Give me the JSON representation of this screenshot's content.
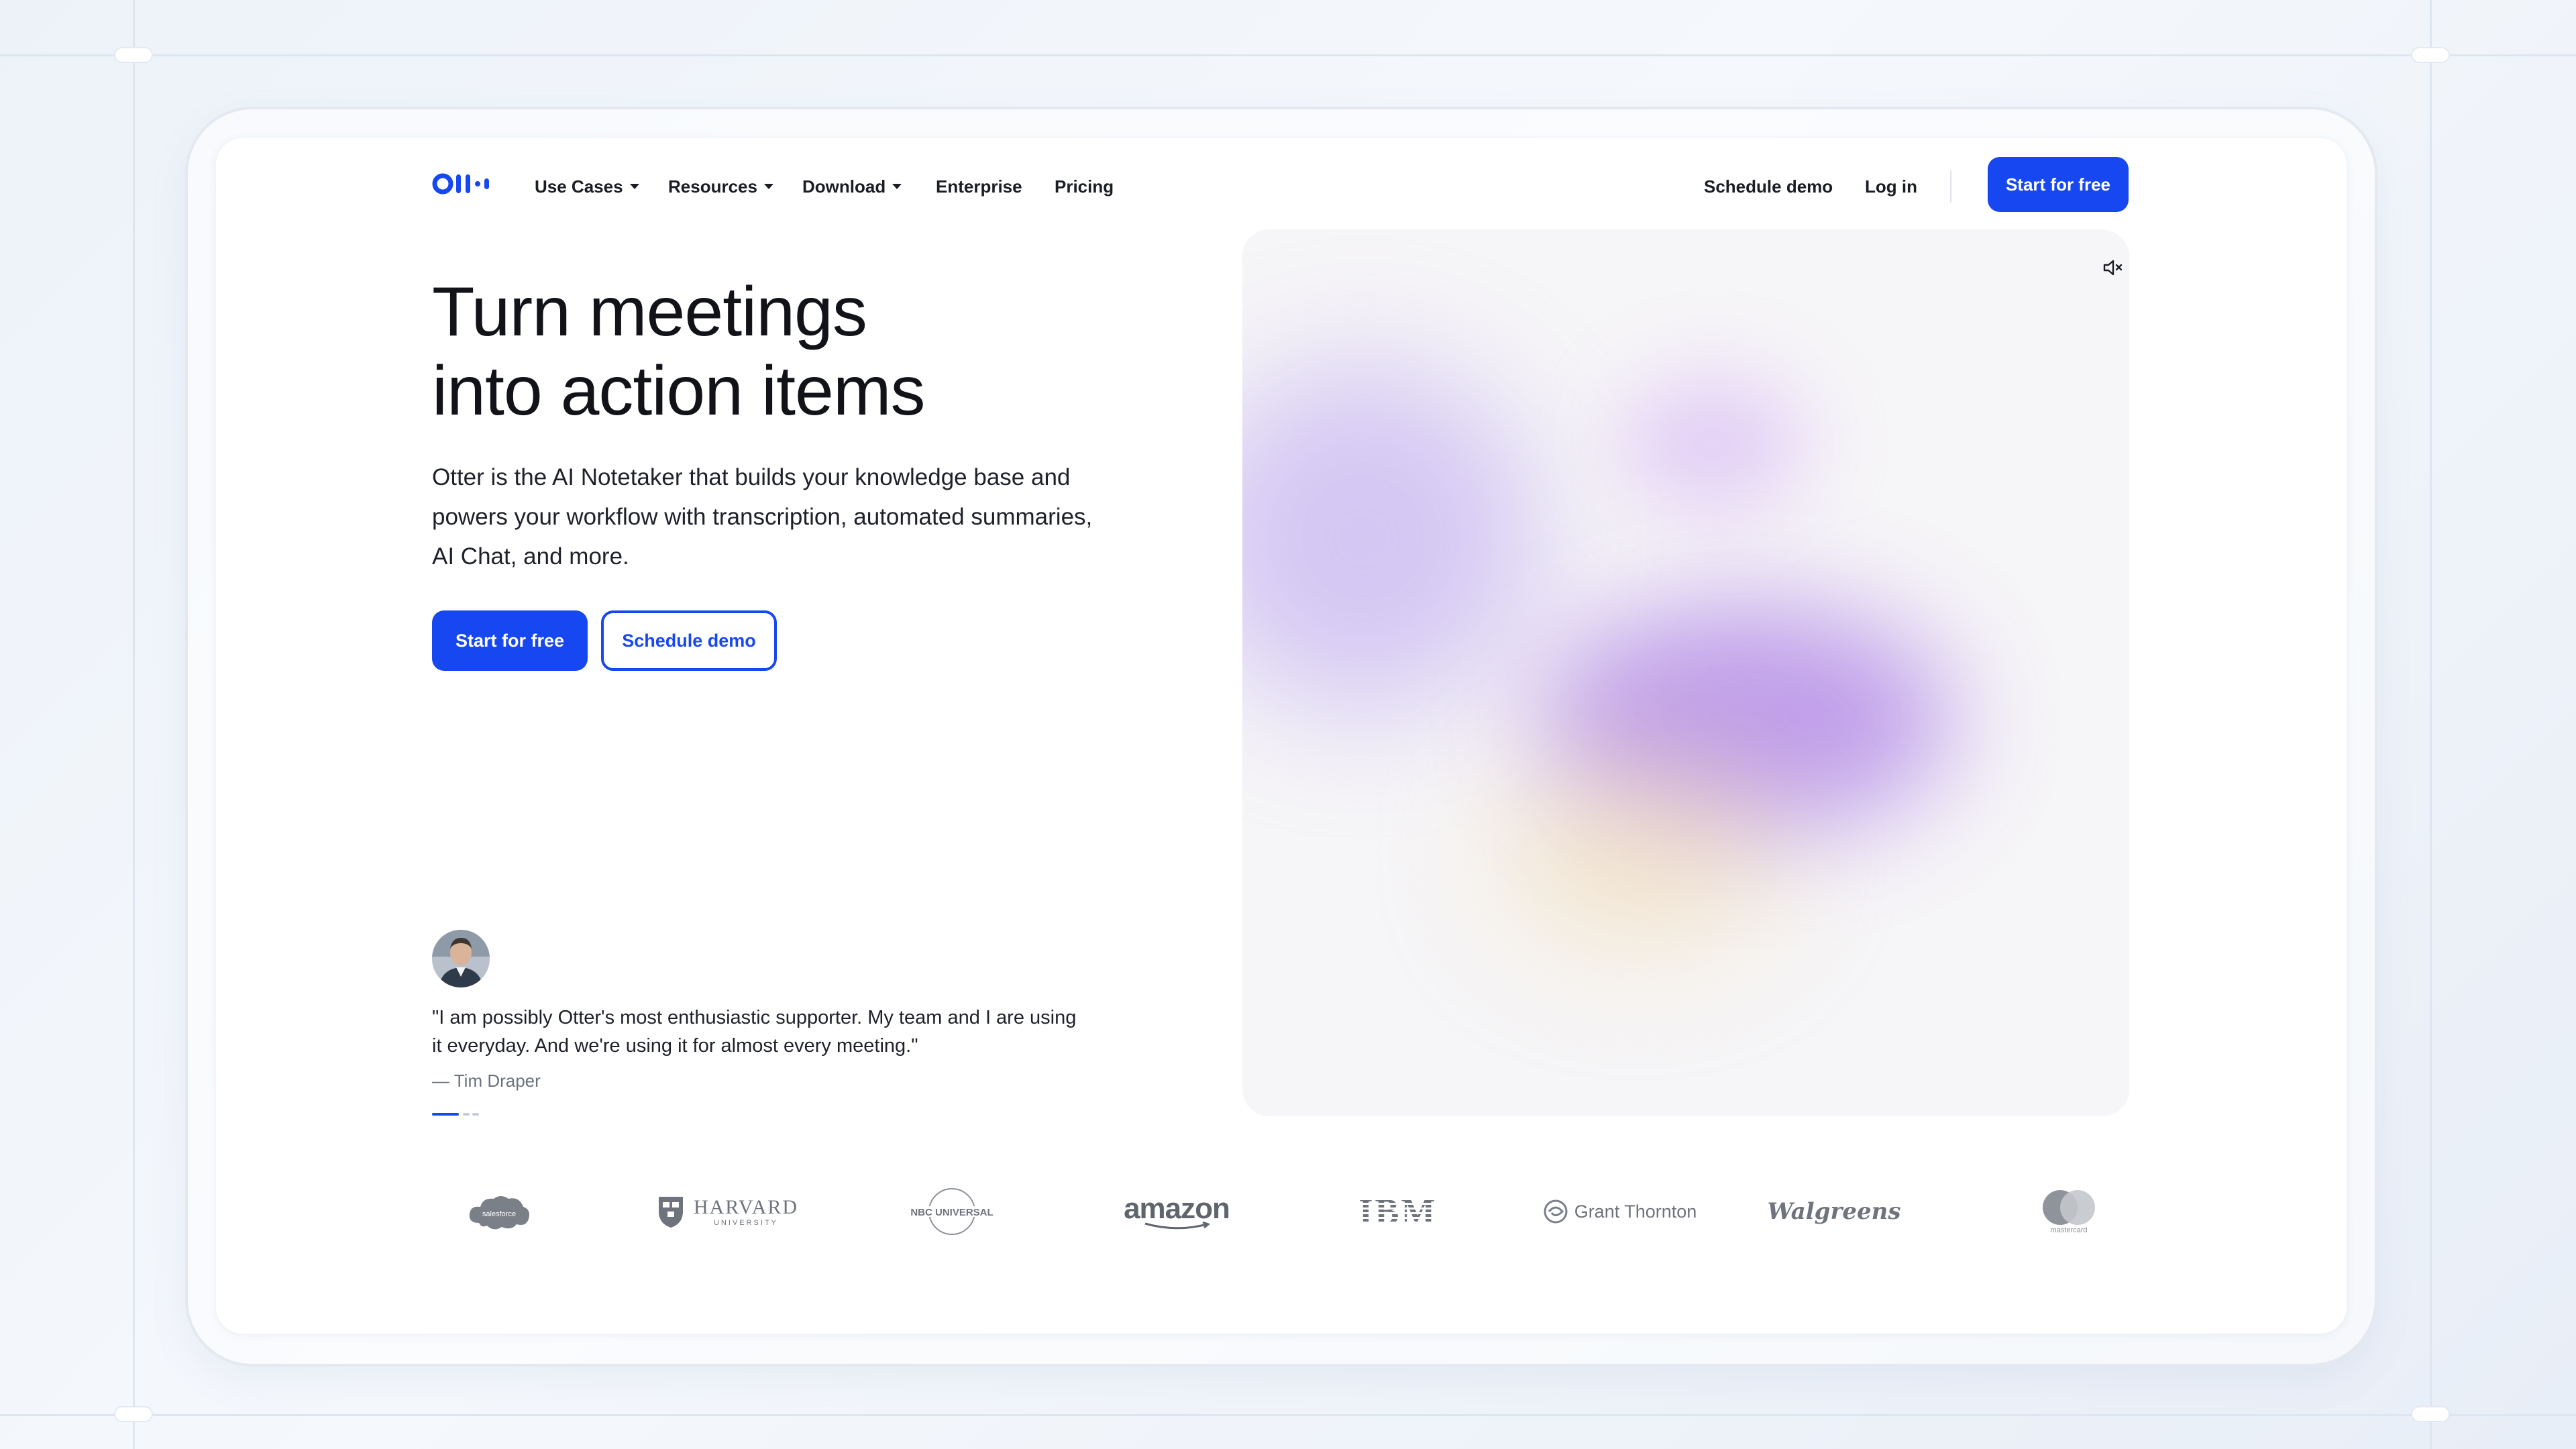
{
  "nav": {
    "items": [
      {
        "label": "Use Cases",
        "dropdown": true
      },
      {
        "label": "Resources",
        "dropdown": true
      },
      {
        "label": "Download",
        "dropdown": true
      },
      {
        "label": "Enterprise",
        "dropdown": false
      },
      {
        "label": "Pricing",
        "dropdown": false
      }
    ],
    "schedule_demo": "Schedule demo",
    "login": "Log in",
    "start_free": "Start for free"
  },
  "hero": {
    "title_line1": "Turn meetings",
    "title_line2": "into action items",
    "subtitle": "Otter is the AI Notetaker that builds your knowledge base and powers your workflow with transcription, automated summaries, AI Chat, and more.",
    "cta_primary": "Start for free",
    "cta_secondary": "Schedule demo"
  },
  "testimonial": {
    "quote": "\"I am possibly Otter's most enthusiastic supporter. My team and I are using it everyday. And we're using it for almost every meeting.\"",
    "author": "— Tim Draper"
  },
  "media": {
    "mute_icon": "speaker-muted-icon"
  },
  "customers": {
    "salesforce": "salesforce",
    "harvard": "HARVARD",
    "harvard_sub": "UNIVERSITY",
    "nbc": "NBC UNIVERSAL",
    "amazon": "amazon",
    "ibm": "IBM",
    "grant": "Grant Thornton",
    "walgreens": "Walgreens",
    "mastercard": "mastercard"
  },
  "colors": {
    "brand": "#1747f0",
    "text": "#111318",
    "muted": "#6e737c"
  }
}
